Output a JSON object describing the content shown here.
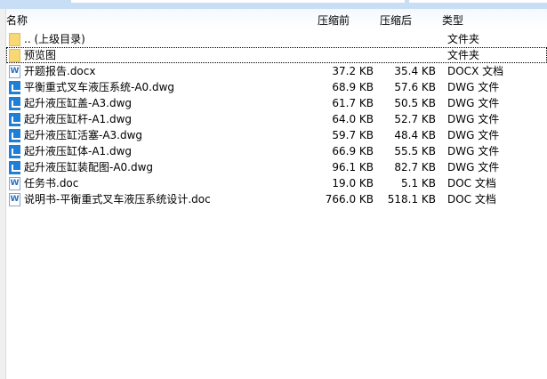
{
  "columns": {
    "name": "名称",
    "before": "压缩前",
    "after": "压缩后",
    "type": "类型"
  },
  "rows": [
    {
      "name": ".. (上级目录)",
      "before": "",
      "after": "",
      "type": "文件夹",
      "icon": "folder"
    },
    {
      "name": "预览图",
      "before": "",
      "after": "",
      "type": "文件夹",
      "icon": "folder"
    },
    {
      "name": "开题报告.docx",
      "before": "37.2 KB",
      "after": "35.4 KB",
      "type": "DOCX 文档",
      "icon": "doc"
    },
    {
      "name": "平衡重式叉车液压系统-A0.dwg",
      "before": "68.9 KB",
      "after": "57.6 KB",
      "type": "DWG 文件",
      "icon": "dwg"
    },
    {
      "name": "起升液压缸盖-A3.dwg",
      "before": "61.7 KB",
      "after": "50.5 KB",
      "type": "DWG 文件",
      "icon": "dwg"
    },
    {
      "name": "起升液压缸杆-A1.dwg",
      "before": "64.0 KB",
      "after": "52.7 KB",
      "type": "DWG 文件",
      "icon": "dwg"
    },
    {
      "name": "起升液压缸活塞-A3.dwg",
      "before": "59.7 KB",
      "after": "48.4 KB",
      "type": "DWG 文件",
      "icon": "dwg"
    },
    {
      "name": "起升液压缸体-A1.dwg",
      "before": "66.9 KB",
      "after": "55.5 KB",
      "type": "DWG 文件",
      "icon": "dwg"
    },
    {
      "name": "起升液压缸装配图-A0.dwg",
      "before": "96.1 KB",
      "after": "82.7 KB",
      "type": "DWG 文件",
      "icon": "dwg"
    },
    {
      "name": "任务书.doc",
      "before": "19.0 KB",
      "after": "5.1 KB",
      "type": "DOC 文档",
      "icon": "doc"
    },
    {
      "name": "说明书-平衡重式叉车液压系统设计.doc",
      "before": "766.0 KB",
      "after": "518.1 KB",
      "type": "DOC 文档",
      "icon": "doc"
    }
  ]
}
